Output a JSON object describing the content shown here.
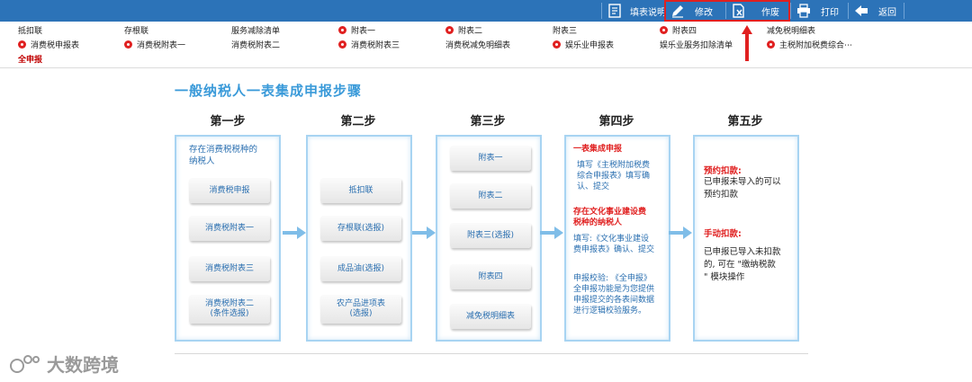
{
  "toolbar": {
    "fill_desc": "填表说明",
    "edit": "修改",
    "void": "作废",
    "print": "打印",
    "back": "返回"
  },
  "nav": {
    "row1": [
      "抵扣联",
      "存根联",
      "服务减除清单",
      "附表一",
      "附表二",
      "附表三",
      "附表四",
      "减免税明细表"
    ],
    "row2": [
      "消费税申报表",
      "消费税附表一",
      "消费税附表二",
      "消费税附表三",
      "消费税减免明细表",
      "娱乐业申报表",
      "娱乐业服务扣除清单",
      "主税附加税费综合⋯"
    ],
    "row3": [
      "全申报"
    ]
  },
  "main": {
    "title": "一般纳税人一表集成申报步骤",
    "steps": [
      "第一步",
      "第二步",
      "第三步",
      "第四步",
      "第五步"
    ],
    "step1": {
      "desc": [
        "存在消费税税种的",
        "纳税人"
      ],
      "items": [
        "消费税申报",
        "消费税附表一",
        "消费税附表三",
        "消费税附表二",
        "(条件选报)"
      ]
    },
    "step2": {
      "items": [
        "抵扣联",
        "存根联(选报)",
        "成品油(选报)",
        "农产品进项表",
        "(选报)"
      ]
    },
    "step3": {
      "items": [
        "附表一",
        "附表二",
        "附表三(选报)",
        "附表四",
        "减免税明细表"
      ]
    },
    "step4": {
      "h1": "一表集成申报",
      "t1": [
        "填写《主税附加税费",
        "综合申报表》填写确",
        "认、提交"
      ],
      "h2": [
        "存在文化事业建设费",
        "税种的纳税人"
      ],
      "t2": [
        "填写:《文化事业建设",
        "费申报表》确认、提交"
      ],
      "t3": [
        "申报校验: 《全申报》",
        "全申报功能是为您提供",
        "申报提交的各表间数据",
        "进行逻辑校验服务。"
      ]
    },
    "step5": {
      "h1": "预约扣款:",
      "t1": [
        "已申报未导入的可以",
        "预约扣款"
      ],
      "h2": "手动扣款:",
      "t2": [
        "已申报已导入未扣款",
        "的, 可在 \"缴纳税款",
        "\" 模块操作"
      ]
    }
  },
  "watermark": "大数跨境"
}
